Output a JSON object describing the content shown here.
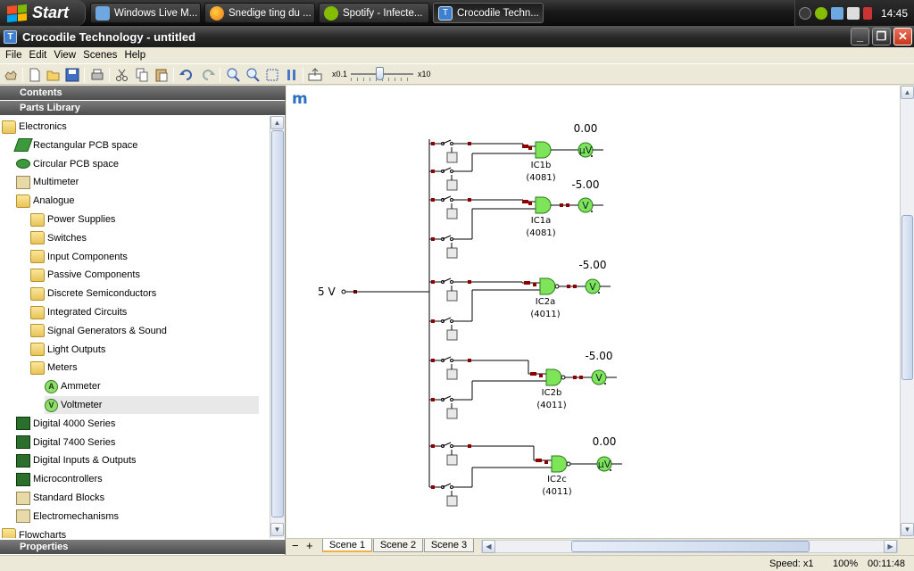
{
  "taskbar": {
    "start_label": "Start",
    "tasks": [
      {
        "label": "Windows Live M...",
        "icon": "messenger-icon",
        "color": "#6fa8e0"
      },
      {
        "label": "Snedige ting du ...",
        "icon": "firefox-icon",
        "color": "#e8761e"
      },
      {
        "label": "Spotify - Infecte...",
        "icon": "spotify-icon",
        "color": "#84bd00"
      },
      {
        "label": "Crocodile Techn...",
        "icon": "crocodile-technology-icon",
        "color": "#3f7fd0"
      }
    ],
    "clock": "14:45"
  },
  "window": {
    "title": "Crocodile Technology - untitled",
    "minimize": "_",
    "maximize": "❐",
    "close": "✕"
  },
  "menu": [
    "File",
    "Edit",
    "View",
    "Scenes",
    "Help"
  ],
  "toolbar": {
    "zoom_min": "x0.1",
    "zoom_max": "x10",
    "zoom_level": 0.45,
    "buttons": [
      "hand-icon",
      "new-icon",
      "open-icon",
      "save-icon",
      "print-icon",
      "cut-icon",
      "copy-icon",
      "paste-icon",
      "undo-icon",
      "redo-icon",
      "zoom-in-icon",
      "zoom-out-icon",
      "zoom-fit-icon",
      "pause-icon",
      "export-icon"
    ]
  },
  "left_panel": {
    "contents_header": "Contents",
    "parts_header": "Parts Library",
    "properties_header": "Properties",
    "tree": [
      {
        "label": "Electronics",
        "level": 0,
        "icon": "folder-open-icon"
      },
      {
        "label": "Rectangular PCB space",
        "level": 1,
        "icon": "rect-pcb-icon"
      },
      {
        "label": "Circular PCB space",
        "level": 1,
        "icon": "circle-pcb-icon"
      },
      {
        "label": "Multimeter",
        "level": 1,
        "icon": "multimeter-icon"
      },
      {
        "label": "Analogue",
        "level": 1,
        "icon": "folder-open-icon"
      },
      {
        "label": "Power Supplies",
        "level": 2,
        "icon": "power-supplies-folder-icon"
      },
      {
        "label": "Switches",
        "level": 2,
        "icon": "switches-folder-icon"
      },
      {
        "label": "Input Components",
        "level": 2,
        "icon": "input-folder-icon"
      },
      {
        "label": "Passive Components",
        "level": 2,
        "icon": "passive-folder-icon"
      },
      {
        "label": "Discrete Semiconductors",
        "level": 2,
        "icon": "semiconductor-folder-icon"
      },
      {
        "label": "Integrated Circuits",
        "level": 2,
        "icon": "ic-folder-icon"
      },
      {
        "label": "Signal Generators & Sound",
        "level": 2,
        "icon": "signal-folder-icon"
      },
      {
        "label": "Light Outputs",
        "level": 2,
        "icon": "light-folder-icon"
      },
      {
        "label": "Meters",
        "level": 2,
        "icon": "meters-folder-icon"
      },
      {
        "label": "Ammeter",
        "level": 3,
        "icon": "ammeter-icon",
        "badge": "A"
      },
      {
        "label": "Voltmeter",
        "level": 3,
        "icon": "voltmeter-icon",
        "badge": "V",
        "selected": true
      },
      {
        "label": "Digital 4000 Series",
        "level": 1,
        "icon": "chip-icon"
      },
      {
        "label": "Digital 7400 Series",
        "level": 1,
        "icon": "chip-icon"
      },
      {
        "label": "Digital Inputs & Outputs",
        "level": 1,
        "icon": "digital-io-icon"
      },
      {
        "label": "Microcontrollers",
        "level": 1,
        "icon": "microcontroller-icon"
      },
      {
        "label": "Standard Blocks",
        "level": 1,
        "icon": "standard-blocks-icon"
      },
      {
        "label": "Electromechanisms",
        "level": 1,
        "icon": "electromechanism-icon"
      },
      {
        "label": "Flowcharts",
        "level": 0,
        "icon": "flowchart-folder-icon"
      }
    ]
  },
  "canvas": {
    "logo": "m",
    "source_label": "5 V",
    "gates": [
      {
        "name": "IC1b",
        "chip": "(4081)",
        "reading": "0.00",
        "meter": "μV"
      },
      {
        "name": "IC1a",
        "chip": "(4081)",
        "reading": "-5.00",
        "meter": "V"
      },
      {
        "name": "IC2a",
        "chip": "(4011)",
        "reading": "-5.00",
        "meter": "V"
      },
      {
        "name": "IC2b",
        "chip": "(4011)",
        "reading": "-5.00",
        "meter": "V"
      },
      {
        "name": "IC2c",
        "chip": "(4011)",
        "reading": "0.00",
        "meter": "μV"
      }
    ],
    "colors": {
      "gate": "#7ee55a",
      "wire": "#000000",
      "pin": "#8b0000"
    }
  },
  "scenes": {
    "minus": "−",
    "plus": "+",
    "tabs": [
      "Scene 1",
      "Scene 2",
      "Scene 3"
    ],
    "active": 0
  },
  "status": {
    "speed": "Speed: x1",
    "zoom": "100%",
    "time": "00:11:48"
  }
}
